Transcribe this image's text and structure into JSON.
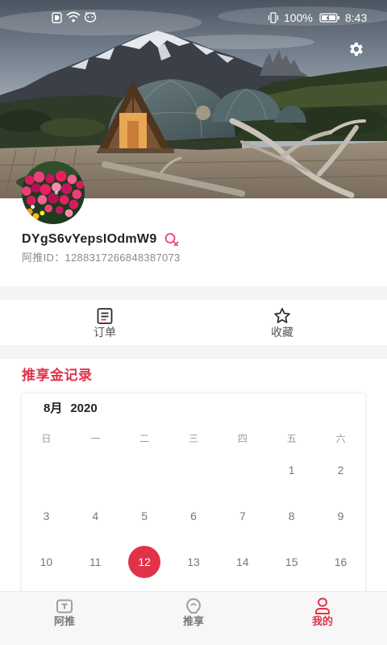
{
  "status_bar": {
    "battery": "100%",
    "time": "8:43",
    "icons": [
      "notification-icon",
      "wifi-icon",
      "face-icon",
      "vibrate-icon",
      "battery-icon"
    ]
  },
  "header": {
    "settings_icon": "gear-icon"
  },
  "profile": {
    "username": "DYgS6vYepsIOdmW9",
    "gender_icon": "female-gender-icon",
    "id_label": "阿推ID：",
    "id_value": "1288317266848387073"
  },
  "tabs": [
    {
      "label": "订单",
      "icon": "order-icon"
    },
    {
      "label": "收藏",
      "icon": "star-icon"
    }
  ],
  "section_title": "推享金记录",
  "calendar": {
    "month": "8月",
    "year": "2020",
    "weekdays": [
      "日",
      "一",
      "二",
      "三",
      "四",
      "五",
      "六"
    ],
    "weeks": [
      [
        "",
        "",
        "",
        "",
        "",
        "1",
        "2"
      ],
      [
        "3",
        "4",
        "5",
        "6",
        "7",
        "8",
        "9"
      ],
      [
        "10",
        "11",
        "12",
        "13",
        "14",
        "15",
        "16"
      ]
    ],
    "selected_day": "12"
  },
  "bottom_nav": [
    {
      "label": "阿推",
      "icon": "tv-icon",
      "active": false
    },
    {
      "label": "推享",
      "icon": "lightbulb-icon",
      "active": false
    },
    {
      "label": "我的",
      "icon": "user-icon",
      "active": true
    }
  ],
  "colors": {
    "accent": "#e0334a",
    "text_primary": "#222222",
    "text_secondary": "#888888",
    "nav_inactive": "#9e9e9e",
    "band": "#f4f4f4"
  }
}
